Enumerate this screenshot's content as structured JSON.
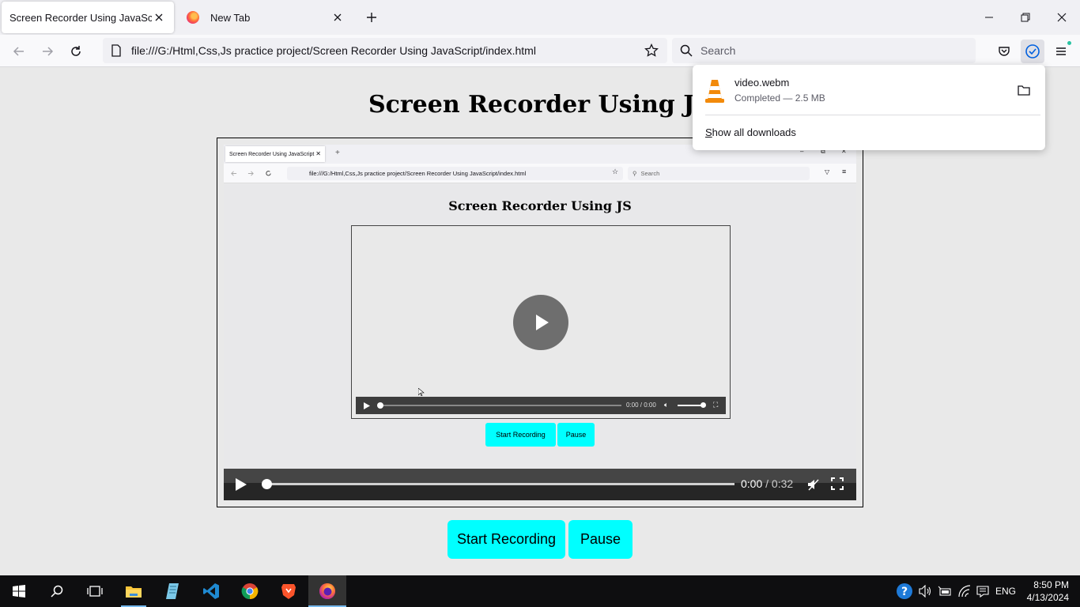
{
  "browser": {
    "tabs": [
      {
        "title": "Screen Recorder Using JavaScript",
        "active": true
      },
      {
        "title": "New Tab",
        "active": false
      }
    ],
    "url": "file:///G:/Html,Css,Js practice project/Screen Recorder Using JavaScript/index.html",
    "search_placeholder": "Search"
  },
  "page": {
    "title": "Screen Recorder Using JS",
    "start_label": "Start Recording",
    "pause_label": "Pause",
    "video": {
      "current_time": "0:00",
      "separator": " / ",
      "duration": "0:32"
    }
  },
  "recorded_frame": {
    "tab_title": "Screen Recorder Using JavaScript",
    "url": "file:///G:/Html,Css,Js practice project/Screen Recorder Using JavaScript/index.html",
    "search_placeholder": "Search",
    "title": "Screen Recorder Using JS",
    "start_label": "Start Recording",
    "pause_label": "Pause",
    "time": "0:00 / 0:00"
  },
  "downloads": {
    "file_name": "video.webm",
    "status": "Completed — 2.5 MB",
    "show_all": "Show all downloads"
  },
  "taskbar": {
    "language": "ENG",
    "time": "8:50 PM",
    "date": "4/13/2024"
  },
  "colors": {
    "button_bg": "#00ffff",
    "accent": "#0060df"
  }
}
